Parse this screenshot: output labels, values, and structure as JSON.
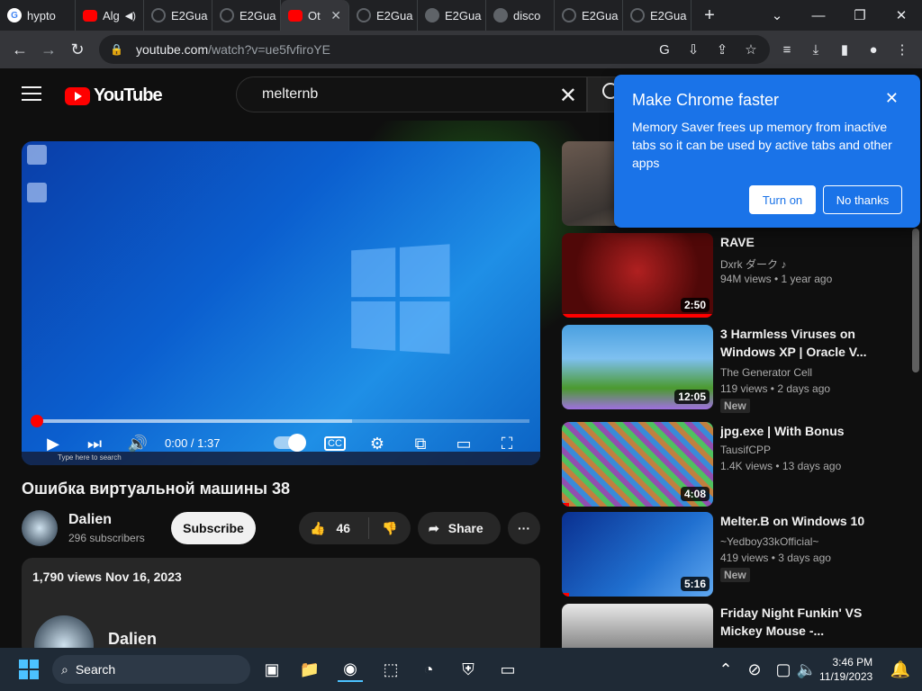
{
  "browser": {
    "tabs": [
      {
        "title": "hypto",
        "icon": "google-icon"
      },
      {
        "title": "Alg",
        "icon": "youtube-icon",
        "audio": true
      },
      {
        "title": "E2Gua",
        "icon": "github-icon"
      },
      {
        "title": "E2Gua",
        "icon": "github-icon"
      },
      {
        "title": "Ot",
        "icon": "youtube-icon",
        "active": true
      },
      {
        "title": "E2Gua",
        "icon": "github-icon"
      },
      {
        "title": "E2Gua",
        "icon": "globe-icon"
      },
      {
        "title": "disco",
        "icon": "globe-icon"
      },
      {
        "title": "E2Gua",
        "icon": "github-icon"
      },
      {
        "title": "E2Gua",
        "icon": "github-icon"
      }
    ],
    "new_tab": "+",
    "url_host": "youtube.com",
    "url_path": "/watch?v=ue5fvfiroYE"
  },
  "yt": {
    "logo_text": "YouTube",
    "search_value": "melternb",
    "video": {
      "time": "0:00 / 1:37",
      "progress": 0.0,
      "buffered": 0.64,
      "title": "Ошибка виртуальной машины 38",
      "taskbar_search": "Type here to search"
    },
    "channel": {
      "name": "Dalien",
      "subscribers": "296 subscribers",
      "subscribe_label": "Subscribe"
    },
    "actions": {
      "likes": "46",
      "share": "Share"
    },
    "description": {
      "meta": "1,790 views  Nov 16, 2023",
      "channel": "Dalien"
    },
    "recommendations": [
      {
        "title": "RAVE",
        "channel": "Dxrk ダーク ♪",
        "meta": "94M views • 1 year ago",
        "duration": "2:50",
        "watched": 1.0,
        "badge": ""
      },
      {
        "title": "3 Harmless Viruses on Windows XP | Oracle V...",
        "channel": "The Generator Cell",
        "meta": "119 views • 2 days ago",
        "duration": "12:05",
        "watched": 0.0,
        "badge": "New"
      },
      {
        "title": "jpg.exe | With Bonus",
        "channel": "TausifCPP",
        "meta": "1.4K views • 13 days ago",
        "duration": "4:08",
        "watched": 0.05,
        "badge": ""
      },
      {
        "title": "Melter.B on Windows 10",
        "channel": "~Yedboy33kOfficial~",
        "meta": "419 views • 3 days ago",
        "duration": "5:16",
        "watched": 0.05,
        "badge": "New"
      },
      {
        "title": "Friday Night Funkin' VS Mickey Mouse -...",
        "channel": "",
        "meta": "",
        "duration": "",
        "watched": 0.0,
        "badge": ""
      }
    ]
  },
  "popup": {
    "title": "Make Chrome faster",
    "body": "Memory Saver frees up memory from inactive tabs so it can be used by active tabs and other apps",
    "turn_on": "Turn on",
    "no_thanks": "No thanks"
  },
  "taskbar": {
    "search_label": "Search",
    "time": "3:46 PM",
    "date": "11/19/2023"
  },
  "colors": {
    "popup": "#1a73e8",
    "yt_red": "#ff0000",
    "background": "#0f0f0f"
  }
}
